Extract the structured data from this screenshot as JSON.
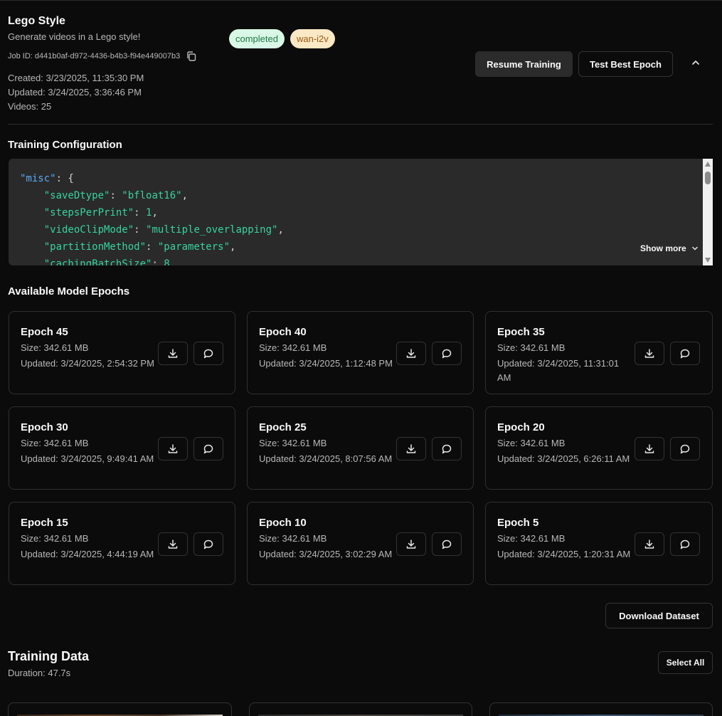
{
  "job": {
    "title": "Lego Style",
    "description": "Generate videos in a Lego style!",
    "job_id_label": "Job ID: d441b0af-d972-4436-b4b3-f94e449007b3",
    "badges": [
      "completed",
      "wan-i2v"
    ],
    "created": "Created: 3/23/2025, 11:35:30 PM",
    "updated": "Updated: 3/24/2025, 3:36:46 PM",
    "videos": "Videos: 25"
  },
  "actions": {
    "resume": "Resume Training",
    "test_best": "Test Best Epoch"
  },
  "config": {
    "section_title": "Training Configuration",
    "show_more": "Show more",
    "lines": {
      "l1_key": "\"misc\"",
      "l1_rest": ": {",
      "l2_key": "\"saveDtype\"",
      "l2_val": "\"bfloat16\"",
      "l3_key": "\"stepsPerPrint\"",
      "l3_val": "1",
      "l4_key": "\"videoClipMode\"",
      "l4_val": "\"multiple_overlapping\"",
      "l5_key": "\"partitionMethod\"",
      "l5_val": "\"parameters\"",
      "l6_key": "\"cachingBatchSize\"",
      "l6_val": "8"
    }
  },
  "epochs": {
    "section_title": "Available Model Epochs",
    "items": [
      {
        "name": "Epoch 45",
        "size": "Size: 342.61 MB",
        "updated": "Updated: 3/24/2025, 2:54:32 PM"
      },
      {
        "name": "Epoch 40",
        "size": "Size: 342.61 MB",
        "updated": "Updated: 3/24/2025, 1:12:48 PM"
      },
      {
        "name": "Epoch 35",
        "size": "Size: 342.61 MB",
        "updated": "Updated: 3/24/2025, 11:31:01 AM"
      },
      {
        "name": "Epoch 30",
        "size": "Size: 342.61 MB",
        "updated": "Updated: 3/24/2025, 9:49:41 AM"
      },
      {
        "name": "Epoch 25",
        "size": "Size: 342.61 MB",
        "updated": "Updated: 3/24/2025, 8:07:56 AM"
      },
      {
        "name": "Epoch 20",
        "size": "Size: 342.61 MB",
        "updated": "Updated: 3/24/2025, 6:26:11 AM"
      },
      {
        "name": "Epoch 15",
        "size": "Size: 342.61 MB",
        "updated": "Updated: 3/24/2025, 4:44:19 AM"
      },
      {
        "name": "Epoch 10",
        "size": "Size: 342.61 MB",
        "updated": "Updated: 3/24/2025, 3:02:29 AM"
      },
      {
        "name": "Epoch 5",
        "size": "Size: 342.61 MB",
        "updated": "Updated: 3/24/2025, 1:20:31 AM"
      }
    ],
    "icons": {
      "download": "download-icon",
      "chat": "chat-bubble-icon"
    }
  },
  "dataset": {
    "download_label": "Download Dataset"
  },
  "training_data": {
    "title": "Training Data",
    "duration": "Duration: 47.7s",
    "select_all": "Select All"
  },
  "colors": {
    "background": "#0b0b0b",
    "code_key": "#38d39f",
    "code_root_key": "#5aa9f5",
    "badge_completed_bg": "#d9f7e6",
    "badge_model_bg": "#fbe8c4"
  }
}
